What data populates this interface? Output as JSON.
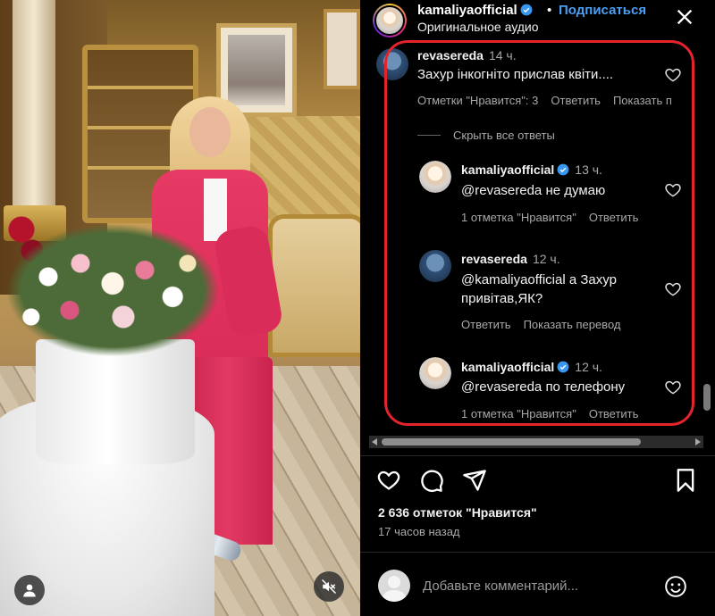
{
  "video": {
    "user_icon": "user-icon",
    "mute_icon": "muted-speaker-icon"
  },
  "header": {
    "username": "kamaliyaofficial",
    "separator": "•",
    "follow_label": "Подписаться",
    "audio_label": "Оригинальное аудио",
    "close_icon": "close-icon"
  },
  "comments": {
    "top": {
      "username": "revasereda",
      "time": "14 ч.",
      "text": "Захур інкогніто прислав квіти....",
      "likes": "Отметки \"Нравится\": 3",
      "reply": "Ответить",
      "translate": "Показать п"
    },
    "hide_replies": "Скрыть все ответы",
    "replies": [
      {
        "username": "kamaliyaofficial",
        "time": "13 ч.",
        "text_line1": "@revasereda не думаю",
        "text_line2": "",
        "likes": "1 отметка \"Нравится\"",
        "reply": "Ответить",
        "extra": ""
      },
      {
        "username": "revasereda",
        "time": "12 ч.",
        "text_line1": "@kamaliyaofficial а Захур",
        "text_line2": "привітав,ЯК?",
        "likes": "",
        "reply": "Ответить",
        "extra": "Показать перевод"
      },
      {
        "username": "kamaliyaofficial",
        "time": "12 ч.",
        "text_line1": "@revasereda по телефону",
        "text_line2": "",
        "likes": "1 отметка \"Нравится\"",
        "reply": "Ответить",
        "extra": ""
      }
    ]
  },
  "stats": {
    "likes": "2 636 отметок \"Нравится\"",
    "time_ago": "17 часов назад"
  },
  "add_comment": {
    "placeholder": "Добавьте комментарий..."
  },
  "colors": {
    "accent": "#4a9ef5",
    "highlight": "#e3242b",
    "verified": "#3897f0"
  }
}
